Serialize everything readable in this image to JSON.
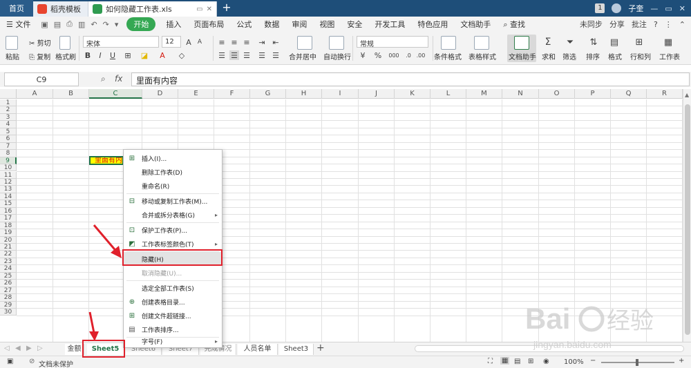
{
  "titlebar": {
    "home": "首页",
    "tabs": [
      {
        "label": "稻壳模板",
        "icon": "daoke-icon",
        "color": "#e8452f"
      },
      {
        "label": "如何隐藏工作表.xls",
        "icon": "spreadsheet-icon",
        "color": "#2f9b50"
      }
    ],
    "new_tab": "+",
    "badge": "1",
    "user": "子奎",
    "controls": [
      "—",
      "▭",
      "✕"
    ]
  },
  "menubar": {
    "file": "文件",
    "items": [
      "开始",
      "插入",
      "页面布局",
      "公式",
      "数据",
      "审阅",
      "视图",
      "安全",
      "开发工具",
      "特色应用",
      "文档助手"
    ],
    "active": "开始",
    "search": "查找",
    "right": [
      "未同步",
      "分享",
      "批注"
    ]
  },
  "ribbon": {
    "paste": "粘贴",
    "cut": "剪切",
    "copy": "复制",
    "format_painter": "格式刷",
    "font_name": "宋体",
    "font_size": "12",
    "bold": "B",
    "italic": "I",
    "underline": "U",
    "merge": "合并居中",
    "wrap": "自动换行",
    "number_format": "常规",
    "percent": "%",
    "thousands": "000",
    "cond_format": "条件格式",
    "table_style": "表格样式",
    "doc_assistant": "文档助手",
    "sum": "求和",
    "filter": "筛选",
    "sort": "排序",
    "format": "格式",
    "rowcol": "行和列",
    "worksheet": "工作表"
  },
  "formula_bar": {
    "cell_ref": "C9",
    "fx": "fx",
    "content": "里面有内容"
  },
  "sheet": {
    "columns": [
      "A",
      "B",
      "C",
      "D",
      "E",
      "F",
      "G",
      "H",
      "I",
      "J",
      "K",
      "L",
      "M",
      "N",
      "O",
      "P",
      "Q",
      "R"
    ],
    "rows": [
      "1",
      "2",
      "3",
      "4",
      "5",
      "6",
      "7",
      "8",
      "9",
      "10",
      "11",
      "12",
      "13",
      "14",
      "15",
      "16",
      "17",
      "18",
      "19",
      "20",
      "21",
      "22",
      "23",
      "24",
      "25",
      "26",
      "27",
      "28",
      "29",
      "30"
    ],
    "cell_c9": "里面有内容",
    "selected_column": "C",
    "selected_row": "9",
    "cell_fill": "#ffff00",
    "cell_text_color": "#d4190f"
  },
  "context_menu": {
    "items": [
      {
        "label": "插入(I)...",
        "icon": "insert-sheet-icon"
      },
      {
        "label": "删除工作表(D)",
        "icon": ""
      },
      {
        "label": "重命名(R)",
        "icon": ""
      },
      {
        "label": "移动或复制工作表(M)...",
        "icon": "move-copy-icon"
      },
      {
        "label": "合并或拆分表格(G)",
        "icon": "",
        "submenu": true
      },
      {
        "label": "保护工作表(P)...",
        "icon": "protect-sheet-icon"
      },
      {
        "label": "工作表标签颜色(T)",
        "icon": "tab-color-icon",
        "submenu": true
      },
      {
        "label": "隐藏(H)",
        "icon": "",
        "highlighted": true
      },
      {
        "label": "取消隐藏(U)...",
        "icon": "",
        "disabled": true
      },
      {
        "label": "选定全部工作表(S)",
        "icon": ""
      },
      {
        "label": "创建表格目录...",
        "icon": "table-catalog-icon"
      },
      {
        "label": "创建文件超链接...",
        "icon": "hyperlink-icon"
      },
      {
        "label": "工作表排序...",
        "icon": "sheet-sort-icon"
      },
      {
        "label": "字号(F)",
        "icon": "",
        "submenu": true
      }
    ]
  },
  "sheet_tabs": {
    "tabs": [
      "金额",
      "Sheet5",
      "Sheet6",
      "Sheet7",
      "完成情况",
      "人员名单",
      "Sheet3"
    ],
    "active": "Sheet5",
    "add": "+"
  },
  "status_bar": {
    "protect": "文档未保护",
    "zoom": "100%",
    "zoom_minus": "−",
    "zoom_plus": "+"
  },
  "watermark": {
    "brand": "Bai",
    "brand2": "经验",
    "url": "jingyan.baidu.com"
  },
  "annotation_color": "#e0202b"
}
